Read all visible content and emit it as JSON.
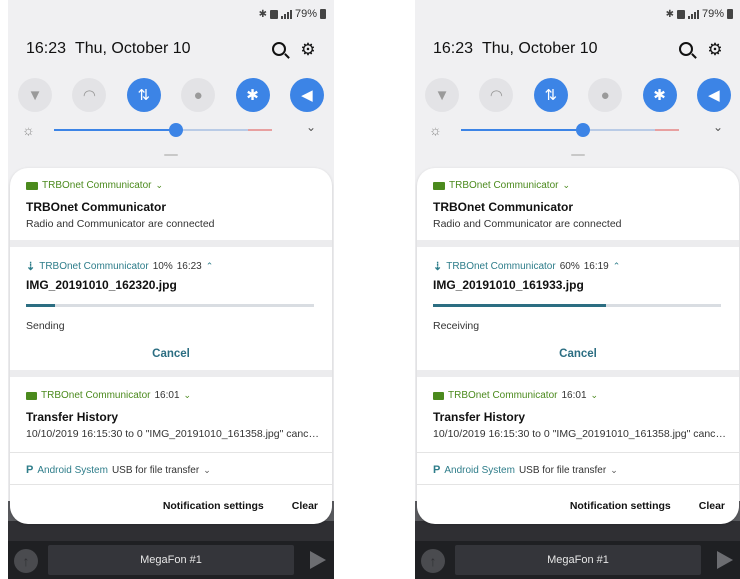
{
  "status_bar": {
    "battery": "79%"
  },
  "header": {
    "time": "16:23",
    "date": "Thu, October 10"
  },
  "colors": {
    "accent": "#3c84e6",
    "green": "#4b8a1d",
    "teal": "#2c6e82"
  },
  "icons": [
    "flashlight-icon",
    "wifi-icon",
    "mobile-data-icon",
    "location-icon",
    "bluetooth-icon",
    "sound-icon",
    "search-icon",
    "gear-icon"
  ],
  "panels": [
    {
      "header_time": "16:23",
      "header_date": "Thu, October 10",
      "notif1": {
        "app": "TRBOnet Communicator",
        "title": "TRBOnet Communicator",
        "text": "Radio and Communicator are connected"
      },
      "transfer": {
        "app": "TRBOnet Communicator",
        "percent": "10%",
        "time": "16:23",
        "progress": 0.1,
        "file": "IMG_20191010_162320.jpg",
        "status": "Sending",
        "cancel": "Cancel"
      },
      "history": {
        "app": "TRBOnet Communicator",
        "time": "16:01",
        "title": "Transfer History",
        "text": "10/10/2019 16:15:30  to 0 \"IMG_20191010_161358.jpg\" cance.."
      },
      "system": {
        "app": "Android System",
        "text": "USB for file transfer"
      },
      "footer": {
        "settings": "Notification settings",
        "clear": "Clear"
      },
      "bottom_field": "MegaFon #1"
    },
    {
      "header_time": "16:23",
      "header_date": "Thu, October 10",
      "notif1": {
        "app": "TRBOnet Communicator",
        "title": "TRBOnet Communicator",
        "text": "Radio and Communicator are connected"
      },
      "transfer": {
        "app": "TRBOnet Communicator",
        "percent": "60%",
        "time": "16:19",
        "progress": 0.6,
        "file": "IMG_20191010_161933.jpg",
        "status": "Receiving",
        "cancel": "Cancel"
      },
      "history": {
        "app": "TRBOnet Communicator",
        "time": "16:01",
        "title": "Transfer History",
        "text": "10/10/2019 16:15:30  to 0 \"IMG_20191010_161358.jpg\" cance.."
      },
      "system": {
        "app": "Android System",
        "text": "USB for file transfer"
      },
      "footer": {
        "settings": "Notification settings",
        "clear": "Clear"
      },
      "bottom_field": "MegaFon #1"
    }
  ]
}
